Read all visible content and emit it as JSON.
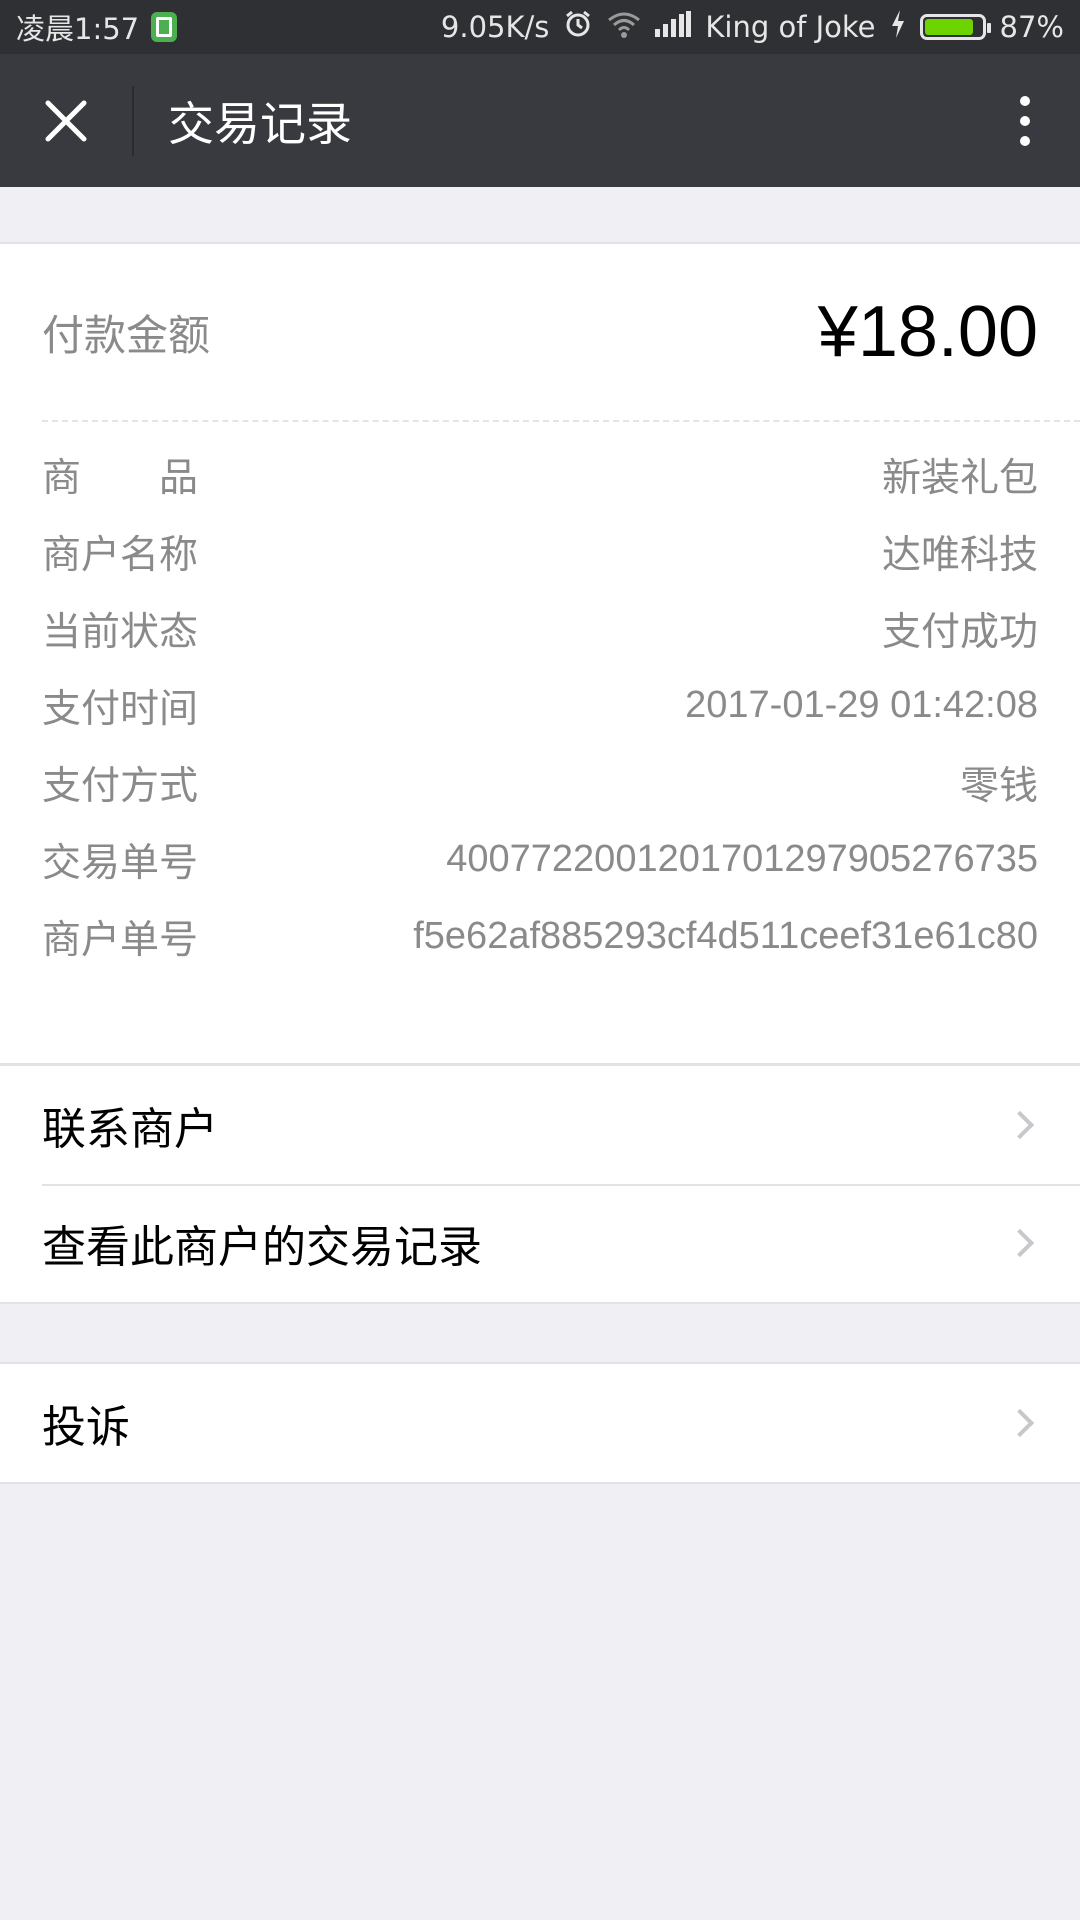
{
  "status_bar": {
    "time": "凌晨1:57",
    "net_speed": "9.05K/s",
    "carrier": "King of Joke",
    "battery": "87%",
    "battery_level": 0.87
  },
  "nav": {
    "title": "交易记录"
  },
  "payment": {
    "amount_label": "付款金额",
    "amount_value": "¥18.00",
    "details": [
      {
        "label": "商　　品",
        "value": "新装礼包"
      },
      {
        "label": "商户名称",
        "value": "达唯科技"
      },
      {
        "label": "当前状态",
        "value": "支付成功"
      },
      {
        "label": "支付时间",
        "value": "2017-01-29 01:42:08"
      },
      {
        "label": "支付方式",
        "value": "零钱"
      },
      {
        "label": "交易单号",
        "value": "4007722001201701297905276735"
      },
      {
        "label": "商户单号",
        "value": "f5e62af885293cf4d511ceef31e61c80"
      }
    ]
  },
  "actions": {
    "contact_merchant": "联系商户",
    "view_merchant_records": "查看此商户的交易记录",
    "complaint": "投诉"
  },
  "colors": {
    "nav_bg": "#393a3f",
    "status_bg": "#2f3033",
    "page_bg": "#efeff4",
    "label_gray": "#8a8a8a",
    "battery_green": "#6dd400"
  }
}
